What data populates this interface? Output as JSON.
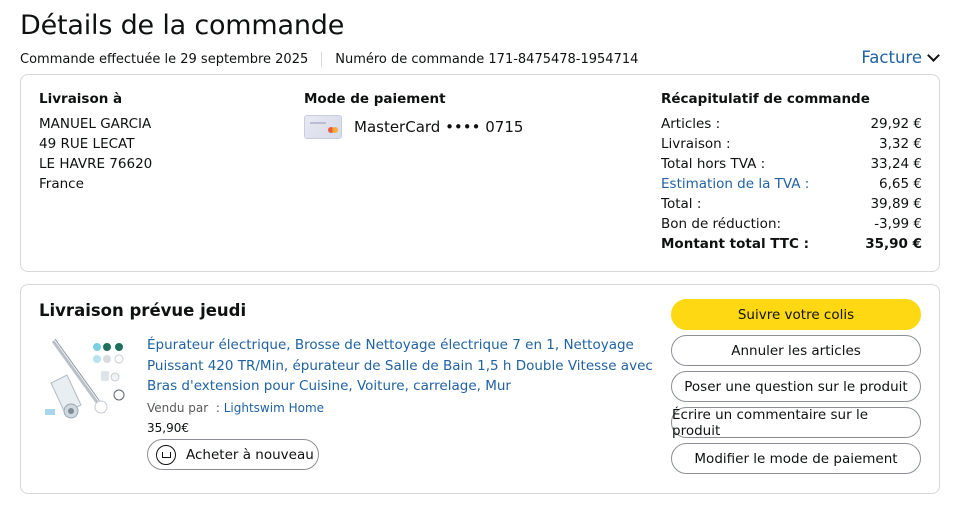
{
  "page": {
    "title": "Détails de la commande",
    "order_date": "Commande effectuée le 29 septembre 2025",
    "order_number": "Numéro de commande 171-8475478-1954714",
    "invoice_label": "Facture"
  },
  "shipping": {
    "title": "Livraison à",
    "lines": [
      "MANUEL GARCIA",
      "49 RUE LECAT",
      "LE HAVRE 76620",
      "France"
    ]
  },
  "payment": {
    "title": "Mode de paiement",
    "card_text": "MasterCard •••• 0715",
    "card_icon": "mastercard-icon"
  },
  "summary": {
    "title": "Récapitulatif de commande",
    "rows": [
      {
        "label": "Articles :",
        "value": "29,92 €"
      },
      {
        "label": "Livraison :",
        "value": "3,32 €"
      },
      {
        "label": "Total hors TVA :",
        "value": "33,24 €"
      },
      {
        "label": "Estimation de la TVA :",
        "value": "6,65 €"
      },
      {
        "label": "Total :",
        "value": "39,89 €"
      },
      {
        "label": "Bon de réduction:",
        "value": "-3,99 €"
      },
      {
        "label": "Montant total TTC :",
        "value": "35,90 €"
      }
    ]
  },
  "delivery": {
    "title": "Livraison prévue jeudi",
    "product": {
      "title": "Épurateur électrique, Brosse de Nettoyage électrique 7 en 1, Nettoyage Puissant 420 TR/Min, épurateur de Salle de Bain 1,5 h Double Vitesse avec Bras d'extension pour Cuisine, Voiture, carrelage, Mur",
      "seller_prefix": "Vendu par",
      "seller_sep": ":",
      "seller": "Lightswim Home",
      "price": "35,90€",
      "buy_again_label": "Acheter à nouveau"
    },
    "actions": [
      "Suivre votre colis",
      "Annuler les articles",
      "Poser une question sur le produit",
      "Écrire un commentaire sur le produit",
      "Modifier le mode de paiement"
    ]
  },
  "colors": {
    "link": "#2162a1",
    "primary_button": "#ffd814",
    "border": "#d5d9d9"
  }
}
